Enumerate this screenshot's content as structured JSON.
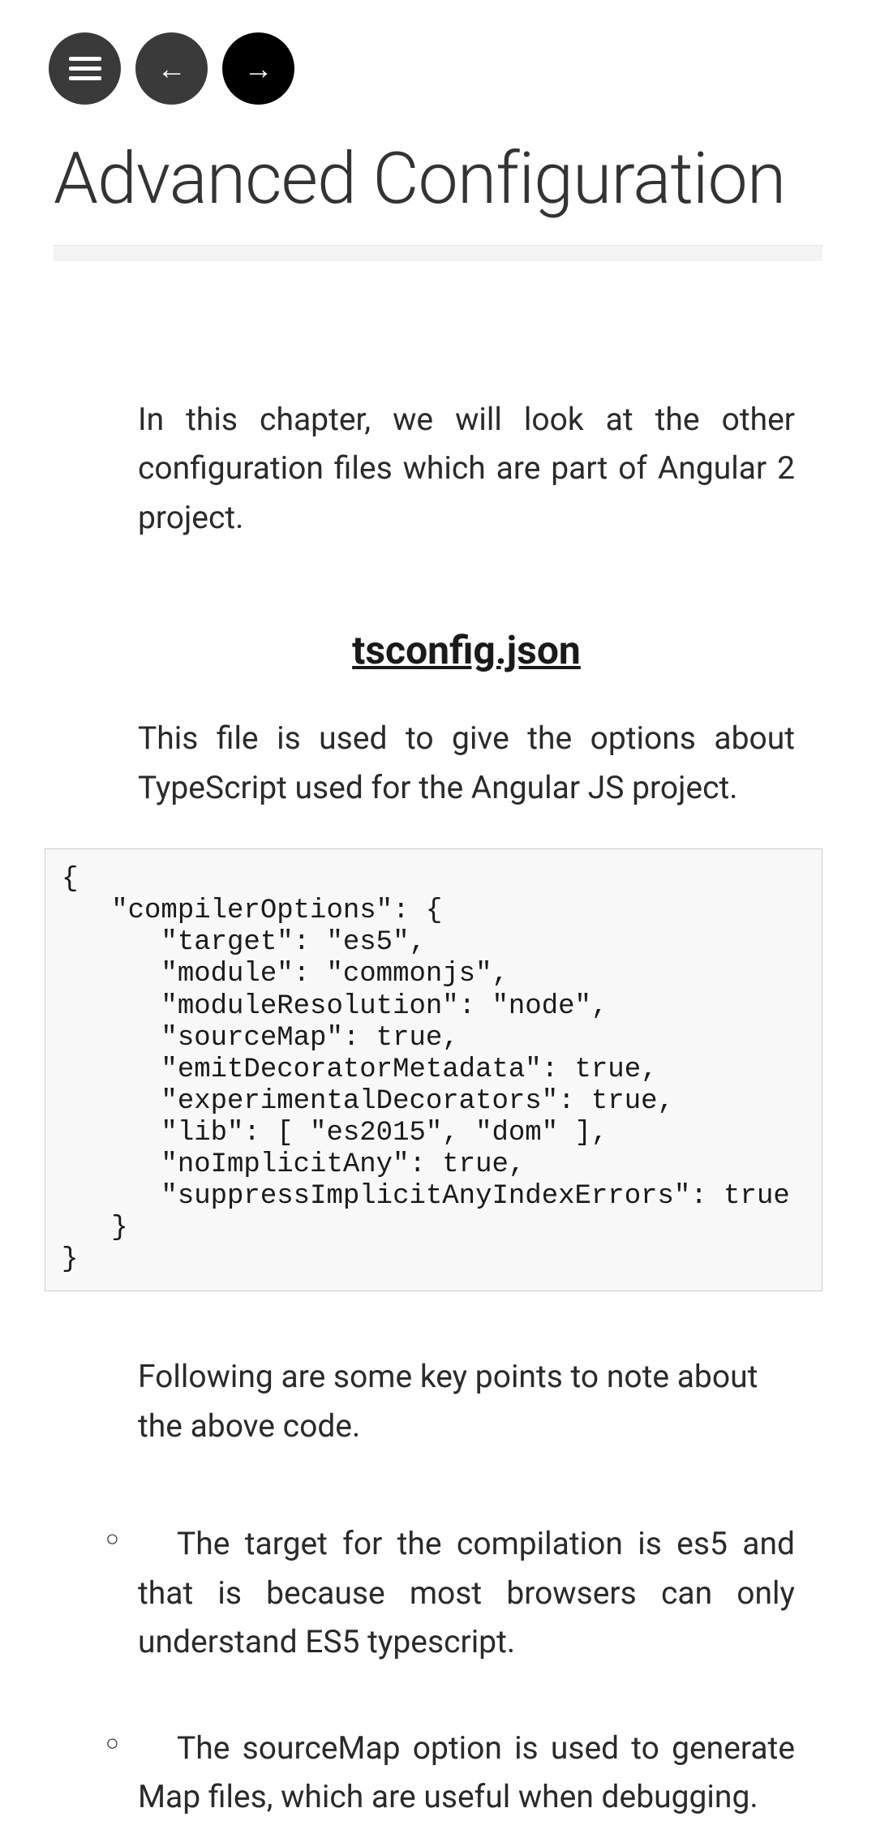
{
  "nav": {
    "menu_label": "menu",
    "back_label": "←",
    "forward_label": "→"
  },
  "page": {
    "title": "Advanced Configuration"
  },
  "content": {
    "intro": "In this chapter, we will look at the other configuration files which are part of Angular 2 project.",
    "section_heading": "tsconfig.json",
    "section_text": "This file is used to give the options about TypeScript used for the Angular JS project.",
    "code": "{ \n   \"compilerOptions\": {\n      \"target\": \"es5\",\n      \"module\": \"commonjs\",\n      \"moduleResolution\": \"node\",\n      \"sourceMap\": true,\n      \"emitDecoratorMetadata\": true,\n      \"experimentalDecorators\": true,\n      \"lib\": [ \"es2015\", \"dom\" ],\n      \"noImplicitAny\": true,\n      \"suppressImplicitAnyIndexErrors\": true\n   }\n}",
    "post_code": "Following are some key points to note about the above code.",
    "bullets": [
      "The target for the compilation is es5 and that is because most browsers can only understand ES5 typescript.",
      "The sourceMap option is used to generate Map files, which are useful when debugging."
    ]
  }
}
